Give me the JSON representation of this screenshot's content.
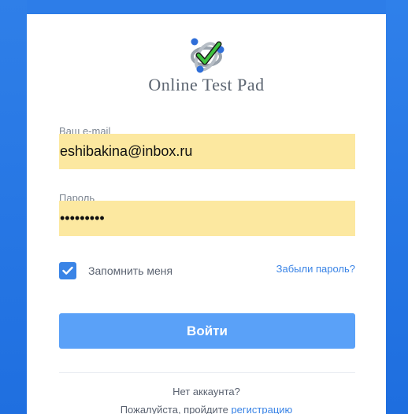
{
  "brand": {
    "name": "Online Test Pad"
  },
  "email": {
    "label": "Ваш e-mail",
    "value": "eshibakina@inbox.ru"
  },
  "password": {
    "label": "Пароль",
    "masked_value": "•••••••••"
  },
  "remember": {
    "label": "Запомнить меня",
    "checked": true
  },
  "forgot": {
    "label": "Забыли пароль?"
  },
  "login": {
    "label": "Войти"
  },
  "register": {
    "no_account": "Нет аккаунта?",
    "please_prefix": "Пожалуйста, пройдите ",
    "link_label": "регистрацию"
  },
  "colors": {
    "accent": "#3a84e6",
    "button": "#5aa1f8",
    "autofill": "#fce8a0",
    "background": "#2d7de8"
  },
  "icons": {
    "logo": "check-orbit-logo-icon",
    "checkbox": "checkmark-icon"
  }
}
